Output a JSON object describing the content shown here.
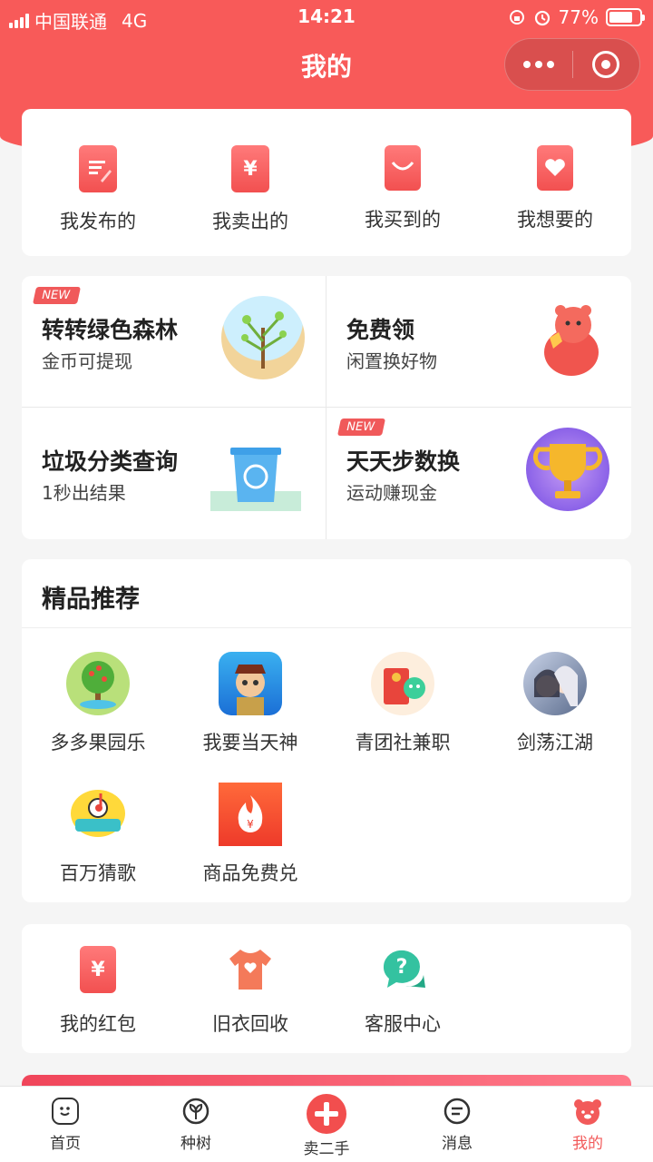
{
  "status_bar": {
    "carrier": "中国联通",
    "network": "4G",
    "time": "14:21",
    "battery": "77%",
    "battery_level": 0.77
  },
  "header": {
    "title": "我的"
  },
  "my_orders": [
    {
      "label": "我发布的",
      "icon": "edit-doc-icon"
    },
    {
      "label": "我卖出的",
      "icon": "yuan-receipt-icon"
    },
    {
      "label": "我买到的",
      "icon": "shopping-bag-icon"
    },
    {
      "label": "我想要的",
      "icon": "heart-card-icon"
    }
  ],
  "promos": [
    {
      "badge": "NEW",
      "title": "转转绿色森林",
      "subtitle": "金币可提现",
      "icon": "tree-icon"
    },
    {
      "badge": "",
      "title": "免费领",
      "subtitle": "闲置换好物",
      "icon": "bear-gift-icon"
    },
    {
      "badge": "",
      "title": "垃圾分类查询",
      "subtitle": "1秒出结果",
      "icon": "recycle-bin-icon"
    },
    {
      "badge": "NEW",
      "title": "天天步数换",
      "subtitle": "运动赚现金",
      "icon": "trophy-icon"
    }
  ],
  "recommend": {
    "title": "精品推荐",
    "apps": [
      {
        "label": "多多果园乐",
        "icon": "fruit-tree-icon"
      },
      {
        "label": "我要当天神",
        "icon": "game-character-icon"
      },
      {
        "label": "青团社兼职",
        "icon": "red-envelope-icon"
      },
      {
        "label": "剑荡江湖",
        "icon": "swordsman-icon"
      },
      {
        "label": "百万猜歌",
        "icon": "music-note-icon"
      },
      {
        "label": "商品免费兑",
        "icon": "flame-yuan-icon"
      }
    ]
  },
  "services": [
    {
      "label": "我的红包",
      "icon": "red-packet-icon"
    },
    {
      "label": "旧衣回收",
      "icon": "tshirt-icon"
    },
    {
      "label": "客服中心",
      "icon": "help-chat-icon"
    }
  ],
  "tabbar": [
    {
      "label": "首页",
      "icon": "home-face-icon",
      "active": false
    },
    {
      "label": "种树",
      "icon": "sprout-icon",
      "active": false
    },
    {
      "label": "卖二手",
      "icon": "plus-icon",
      "active": false
    },
    {
      "label": "消息",
      "icon": "message-icon",
      "active": false
    },
    {
      "label": "我的",
      "icon": "bear-profile-icon",
      "active": true
    }
  ],
  "colors": {
    "brand": "#f85a59",
    "accent": "#f24e4e"
  }
}
